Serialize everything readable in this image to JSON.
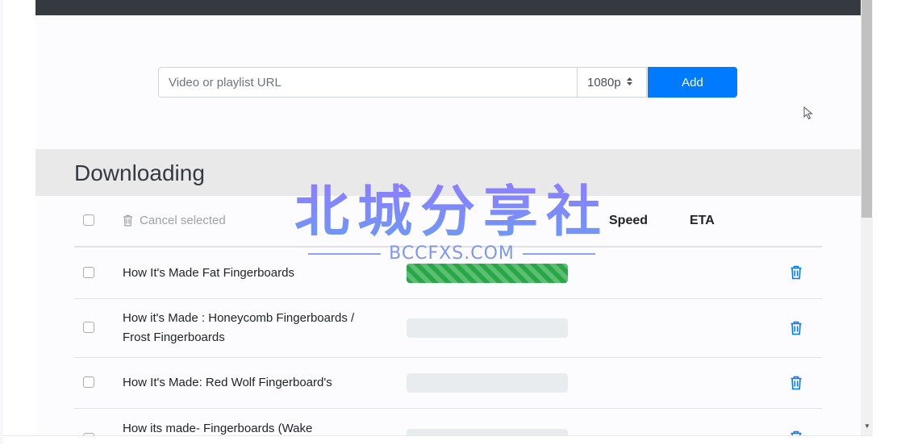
{
  "add_bar": {
    "url_placeholder": "Video or playlist URL",
    "quality_value": "1080p",
    "add_label": "Add"
  },
  "downloading": {
    "title": "Downloading",
    "cancel_selected_label": "Cancel selected",
    "columns": {
      "speed": "Speed",
      "eta": "ETA"
    },
    "rows": [
      {
        "title": "How It's Made Fat Fingerboards",
        "progress": 1.0
      },
      {
        "title": "How it's Made : Honeycomb Fingerboards / Frost Fingerboards",
        "progress": 0
      },
      {
        "title": "How It's Made: Red Wolf Fingerboard's",
        "progress": 0
      },
      {
        "title": "How its made- Fingerboards (Wake",
        "progress": 0
      }
    ]
  },
  "watermark": {
    "chinese": "北城分享社",
    "english": "BCCFXS.COM"
  },
  "colors": {
    "navbar": "#343a40",
    "primary": "#007bff",
    "progress_fill": "#28a745",
    "section_header_bg": "#e9e9ea"
  },
  "icons": [
    "trash-icon",
    "sort-caret-icon",
    "mouse-cursor-icon"
  ]
}
